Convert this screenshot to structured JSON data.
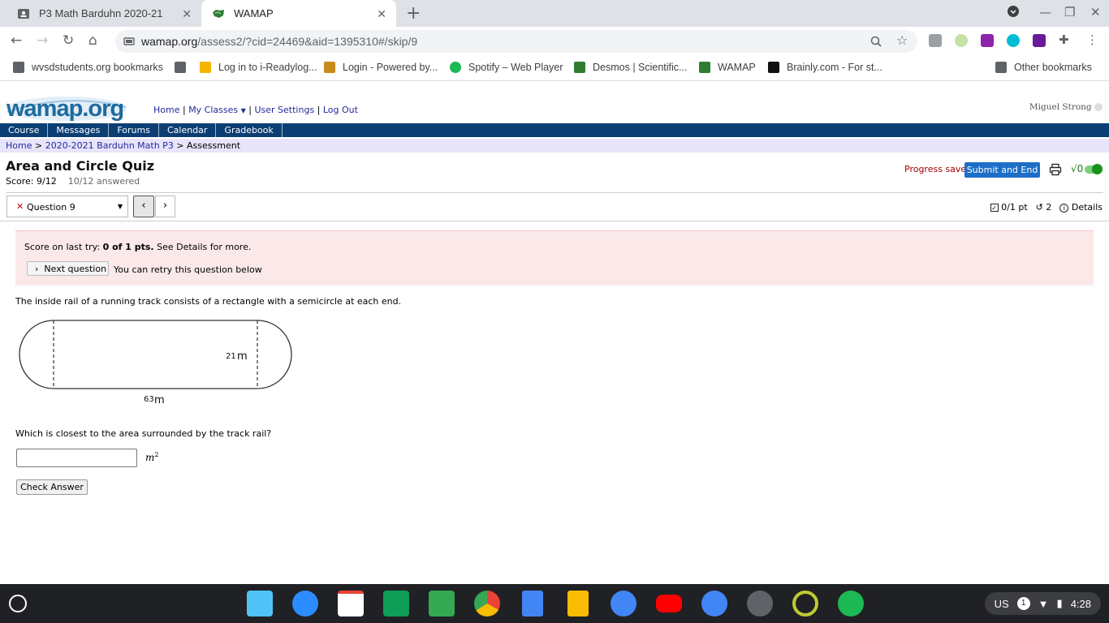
{
  "browser": {
    "tabs": [
      {
        "title": "P3 Math Barduhn 2020-21",
        "active": false,
        "icon": "classroom-icon"
      },
      {
        "title": "WAMAP",
        "active": true,
        "icon": "wamap-icon"
      }
    ],
    "url_host": "wamap.org",
    "url_path": "/assess2/?cid=24469&aid=1395310#/skip/9",
    "bookmarks": [
      "wvsdstudents.org bookmarks",
      "Log in to i-Readylog...",
      "Login - Powered by...",
      "Spotify – Web Player",
      "Desmos | Scientific...",
      "WAMAP",
      "Brainly.com - For st...",
      "Other bookmarks"
    ]
  },
  "site": {
    "logo_text": "wamap.org",
    "topnav": {
      "home": "Home",
      "my_classes": "My Classes",
      "user_settings": "User Settings",
      "logout": "Log Out"
    },
    "username": "Miguel Strong",
    "mainnav": [
      "Course",
      "Messages",
      "Forums",
      "Calendar",
      "Gradebook"
    ],
    "breadcrumb": {
      "home": "Home",
      "course": "2020-2021 Barduhn Math P3",
      "current": "Assessment"
    }
  },
  "assessment": {
    "title": "Area and Circle Quiz",
    "score": "Score: 9/12",
    "answered": "10/12 answered",
    "progress_saved": "Progress saved",
    "submit_label": "Submit and End",
    "math_toggle": "√0",
    "question_select": "Question 9",
    "points": "0/1 pt",
    "retries": "2",
    "details": "Details"
  },
  "feedback": {
    "prefix": "Score on last try: ",
    "score": "0 of 1 pts.",
    "suffix": " See Details for more.",
    "next_label": "Next question",
    "retry_text": "You can retry this question below"
  },
  "question": {
    "text": "The inside rail of a running track consists of a rectangle with a semicircle at each end.",
    "figure_height_label": "21",
    "figure_length_label": "63",
    "figure_unit": "m",
    "prompt": "Which is closest to the area surrounded by the track rail?",
    "answer_value": "",
    "unit": "m",
    "unit_exp": "2",
    "check_label": "Check Answer"
  },
  "shelf": {
    "time": "4:28",
    "locale": "US",
    "notif_count": "1"
  }
}
